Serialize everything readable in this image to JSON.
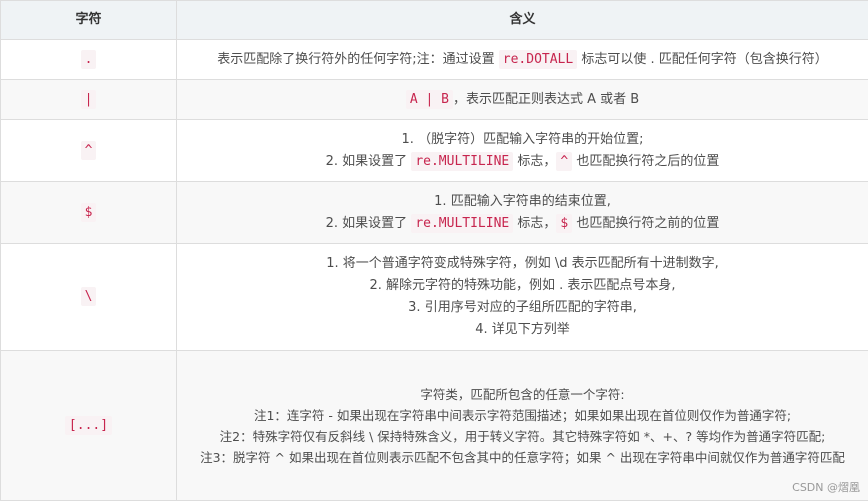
{
  "table": {
    "headers": {
      "char": "字符",
      "meaning": "含义"
    },
    "rows": [
      {
        "char": ".",
        "meaning": {
          "before": "表示匹配除了换行符外的任何字符;注：通过设置 ",
          "code": "re.DOTALL",
          "after": " 标志可以使 . 匹配任何字符（包含换行符）"
        }
      },
      {
        "char": "|",
        "meaning": {
          "code": "A | B",
          "after": "，表示匹配正则表达式 A 或者 B"
        }
      },
      {
        "char": "^",
        "meaning": {
          "line1": "1. （脱字符）匹配输入字符串的开始位置;",
          "line2_before": "2. 如果设置了 ",
          "line2_code": "re.MULTILINE",
          "line2_mid": " 标志，",
          "line2_code2": "^",
          "line2_after": " 也匹配换行符之后的位置"
        }
      },
      {
        "char": "$",
        "meaning": {
          "line1": "1. 匹配输入字符串的结束位置,",
          "line2_before": "2. 如果设置了 ",
          "line2_code": "re.MULTILINE",
          "line2_mid": " 标志，",
          "line2_code2": "$",
          "line2_after": " 也匹配换行符之前的位置"
        }
      },
      {
        "char": "\\",
        "meaning": {
          "lines": [
            "1. 将一个普通字符变成特殊字符，例如 \\d 表示匹配所有十进制数字,",
            "2. 解除元字符的特殊功能，例如 . 表示匹配点号本身,",
            "3. 引用序号对应的子组所匹配的字符串,",
            "4. 详见下方列举"
          ]
        }
      },
      {
        "char": "[...]",
        "meaning": {
          "lines": [
            "字符类，匹配所包含的任意一个字符:",
            "注1：连字符 - 如果出现在字符串中间表示字符范围描述；如果如果出现在首位则仅作为普通字符;",
            "注2：特殊字符仅有反斜线 \\ 保持特殊含义，用于转义字符。其它特殊字符如 *、+、? 等均作为普通字符匹配;",
            "注3：脱字符 ^ 如果出现在首位则表示匹配不包含其中的任意字符；如果 ^ 出现在字符串中间就仅作为普通字符匹配"
          ]
        }
      }
    ]
  },
  "watermark": "CSDN @熠凰",
  "colors": {
    "header_bg": "#eff3f5",
    "code_text": "#c7254e",
    "code_bg": "#f9f2f4",
    "border": "#dddddd"
  }
}
